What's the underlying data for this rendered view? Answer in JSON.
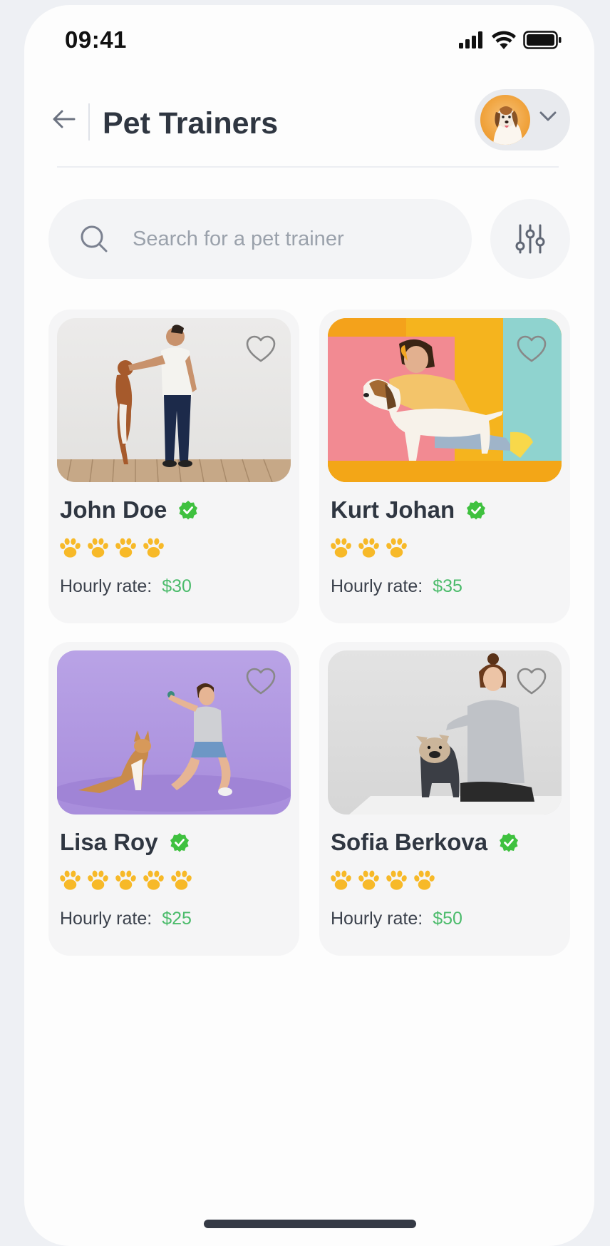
{
  "status_bar": {
    "time": "09:41"
  },
  "header": {
    "title": "Pet Trainers"
  },
  "search": {
    "placeholder": "Search for a pet trainer"
  },
  "colors": {
    "accent_green": "#4bbb6b",
    "paw_yellow": "#f7b928",
    "title_dark": "#2f3641"
  },
  "rate_label": "Hourly rate:",
  "trainers": [
    {
      "name": "John Doe",
      "rating": 4,
      "rate": "$30",
      "verified": true
    },
    {
      "name": "Kurt Johan",
      "rating": 3,
      "rate": "$35",
      "verified": true
    },
    {
      "name": "Lisa Roy",
      "rating": 5,
      "rate": "$25",
      "verified": true
    },
    {
      "name": "Sofia Berkova",
      "rating": 4,
      "rate": "$50",
      "verified": true
    }
  ],
  "icons": [
    "back-arrow-icon",
    "chevron-down-icon",
    "search-icon",
    "filter-sliders-icon",
    "heart-icon",
    "verified-badge-icon",
    "paw-icon"
  ]
}
